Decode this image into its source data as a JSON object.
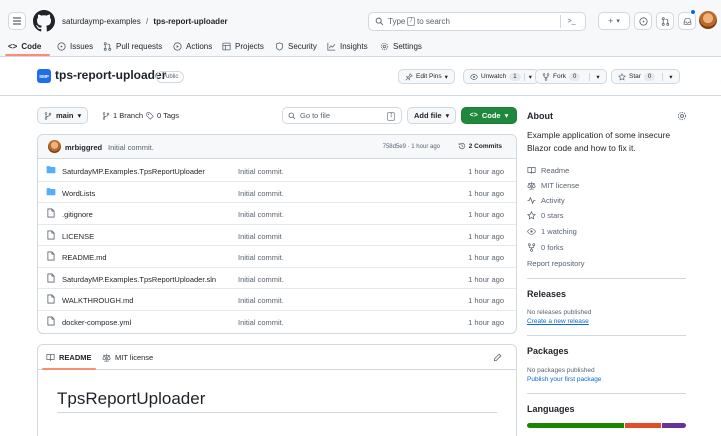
{
  "header": {
    "owner": "saturdaymp-examples",
    "separator": "/",
    "repo": "tps-report-uploader",
    "search_prefix": "Type",
    "search_key": "/",
    "search_suffix": "to search",
    "plus_label": "+",
    "chevron": "▾",
    "terminal_label": ">_"
  },
  "nav": {
    "tabs": [
      {
        "label": "Code"
      },
      {
        "label": "Issues"
      },
      {
        "label": "Pull requests"
      },
      {
        "label": "Actions"
      },
      {
        "label": "Projects"
      },
      {
        "label": "Security"
      },
      {
        "label": "Insights"
      },
      {
        "label": "Settings"
      }
    ]
  },
  "repo": {
    "name": "tps-report-uploader",
    "visibility": "Public",
    "avatar_text": "SMP",
    "edit_pins": "Edit Pins",
    "unwatch": "Unwatch",
    "unwatch_count": "1",
    "fork": "Fork",
    "fork_count": "0",
    "star": "Star",
    "star_count": "0"
  },
  "toolbar": {
    "branch": "main",
    "branches": "1 Branch",
    "tags": "0 Tags",
    "goto_placeholder": "Go to file",
    "goto_key": "t",
    "add_file": "Add file",
    "code": "Code"
  },
  "commit": {
    "author": "mrbiggred",
    "message": "Initial commit.",
    "hash_time": "758d5e9 · 1 hour ago",
    "commits": "2 Commits"
  },
  "files": [
    {
      "name": "SaturdayMP.Examples.TpsReportUploader",
      "type": "folder",
      "message": "Initial commit.",
      "date": "1 hour ago"
    },
    {
      "name": "WordLists",
      "type": "folder",
      "message": "Initial commit.",
      "date": "1 hour ago"
    },
    {
      "name": ".gitignore",
      "type": "file",
      "message": "Initial commit.",
      "date": "1 hour ago"
    },
    {
      "name": "LICENSE",
      "type": "file",
      "message": "Initial commit",
      "date": "1 hour ago"
    },
    {
      "name": "README.md",
      "type": "file",
      "message": "Initial commit.",
      "date": "1 hour ago"
    },
    {
      "name": "SaturdayMP.Examples.TpsReportUploader.sln",
      "type": "file",
      "message": "Initial commit.",
      "date": "1 hour ago"
    },
    {
      "name": "WALKTHROUGH.md",
      "type": "file",
      "message": "Initial commit.",
      "date": "1 hour ago"
    },
    {
      "name": "docker-compose.yml",
      "type": "file",
      "message": "Initial commit.",
      "date": "1 hour ago"
    }
  ],
  "readme": {
    "tab_readme": "README",
    "tab_license": "MIT license",
    "heading": "TpsReportUploader"
  },
  "about": {
    "title": "About",
    "description": "Example application of some insecure Blazor code and how to fix it.",
    "readme": "Readme",
    "license": "MIT license",
    "activity": "Activity",
    "stars": "0 stars",
    "watching": "1 watching",
    "forks": "0 forks",
    "report": "Report repository"
  },
  "releases": {
    "title": "Releases",
    "none": "No releases published",
    "create": "Create a new release"
  },
  "packages": {
    "title": "Packages",
    "none": "No packages published",
    "publish": "Publish your first package"
  },
  "languages": {
    "title": "Languages",
    "bar": [
      {
        "fraction": 0.62,
        "color": "#178600"
      },
      {
        "fraction": 0.23,
        "color": "#e34c26"
      },
      {
        "fraction": 0.15,
        "color": "#663399"
      }
    ]
  }
}
